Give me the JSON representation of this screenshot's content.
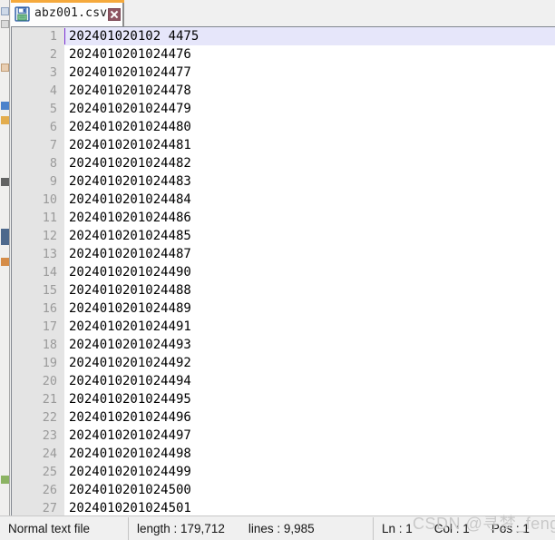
{
  "window": {
    "app": "Notepad++",
    "accent_orange": "#f5a93c",
    "current_line_highlight": "#e6e6fa",
    "gutter_color": "#e4e4e4"
  },
  "tab": {
    "save_icon": "floppy-disk-save-icon",
    "filename": "abz001.csv",
    "close_label": "close-tab-icon"
  },
  "editor": {
    "lines": [
      {
        "num": "1",
        "text": "202401020102 4475"
      },
      {
        "num": "2",
        "text": "2024010201024476"
      },
      {
        "num": "3",
        "text": "2024010201024477"
      },
      {
        "num": "4",
        "text": "2024010201024478"
      },
      {
        "num": "5",
        "text": "2024010201024479"
      },
      {
        "num": "6",
        "text": "2024010201024480"
      },
      {
        "num": "7",
        "text": "2024010201024481"
      },
      {
        "num": "8",
        "text": "2024010201024482"
      },
      {
        "num": "9",
        "text": "2024010201024483"
      },
      {
        "num": "10",
        "text": "2024010201024484"
      },
      {
        "num": "11",
        "text": "2024010201024486"
      },
      {
        "num": "12",
        "text": "2024010201024485"
      },
      {
        "num": "13",
        "text": "2024010201024487"
      },
      {
        "num": "14",
        "text": "2024010201024490"
      },
      {
        "num": "15",
        "text": "2024010201024488"
      },
      {
        "num": "16",
        "text": "2024010201024489"
      },
      {
        "num": "17",
        "text": "2024010201024491"
      },
      {
        "num": "18",
        "text": "2024010201024493"
      },
      {
        "num": "19",
        "text": "2024010201024492"
      },
      {
        "num": "20",
        "text": "2024010201024494"
      },
      {
        "num": "21",
        "text": "2024010201024495"
      },
      {
        "num": "22",
        "text": "2024010201024496"
      },
      {
        "num": "23",
        "text": "2024010201024497"
      },
      {
        "num": "24",
        "text": "2024010201024498"
      },
      {
        "num": "25",
        "text": "2024010201024499"
      },
      {
        "num": "26",
        "text": "2024010201024500"
      },
      {
        "num": "27",
        "text": "2024010201024501"
      }
    ]
  },
  "statusbar": {
    "doc_type": "Normal text file",
    "length": "length : 179,712",
    "lines": "lines : 9,985",
    "ln": "Ln : 1",
    "col": "Col : 1",
    "pos": "Pos : 1"
  },
  "watermark": {
    "text": "CSDN @寻梦_feng"
  }
}
